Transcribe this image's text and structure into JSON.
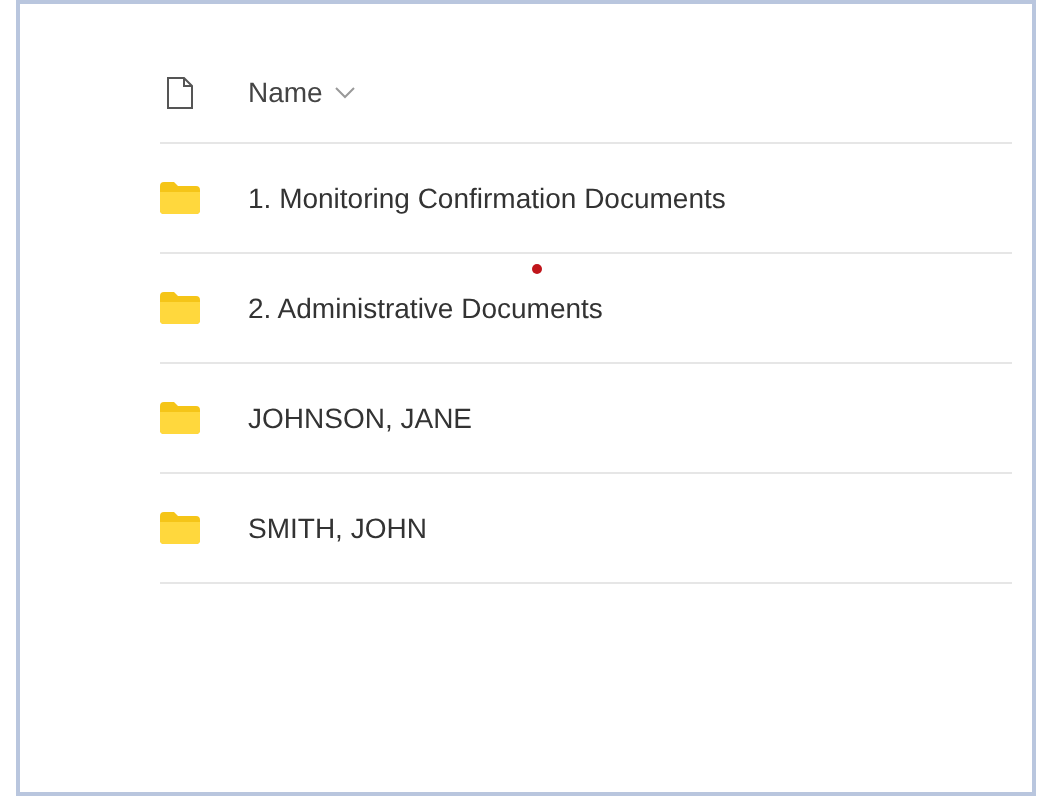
{
  "header": {
    "column": "Name"
  },
  "rows": [
    {
      "name": "1. Monitoring Confirmation Documents"
    },
    {
      "name": "2. Administrative Documents"
    },
    {
      "name": "JOHNSON, JANE"
    },
    {
      "name": "SMITH, JOHN"
    }
  ]
}
